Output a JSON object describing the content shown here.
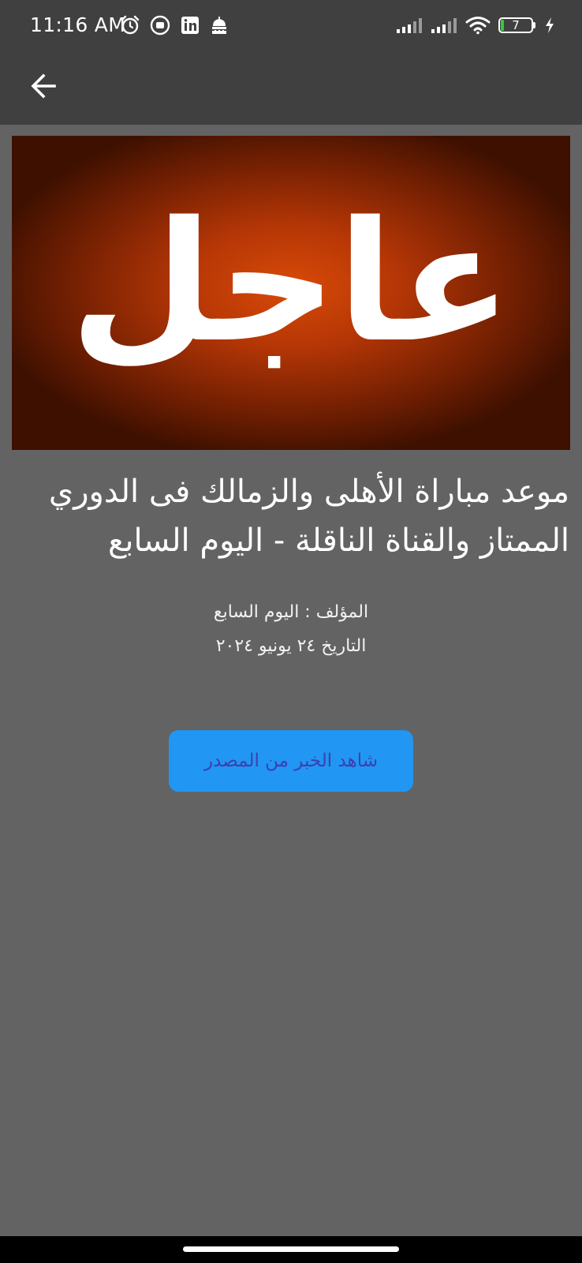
{
  "status_bar": {
    "time": "11:16 AM",
    "left_icons": [
      "alarm-icon",
      "notification-app-icon",
      "linkedin-icon",
      "mosque-icon"
    ],
    "right_icons": [
      "signal-icon",
      "signal-icon",
      "wifi-icon",
      "battery-icon",
      "charging-icon"
    ],
    "battery_level": "7"
  },
  "app_bar": {
    "back_icon": "arrow-left-icon"
  },
  "article": {
    "banner_text": "عاجل",
    "headline_line1": "موعد مباراة الأهلى والزمالك فى الدوري",
    "headline_line2": "الممتاز والقناة الناقلة - اليوم السابع",
    "author": "المؤلف : اليوم السابع",
    "date": "التاريخ  ٢٤ يونيو ٢٠٢٤",
    "source_button_label": "شاهد الخبر من المصدر"
  },
  "colors": {
    "app_bar": "#404040",
    "background": "#636363",
    "button": "#2196f3",
    "button_text": "#3e3fb0",
    "banner_orange": "#d84a08"
  }
}
